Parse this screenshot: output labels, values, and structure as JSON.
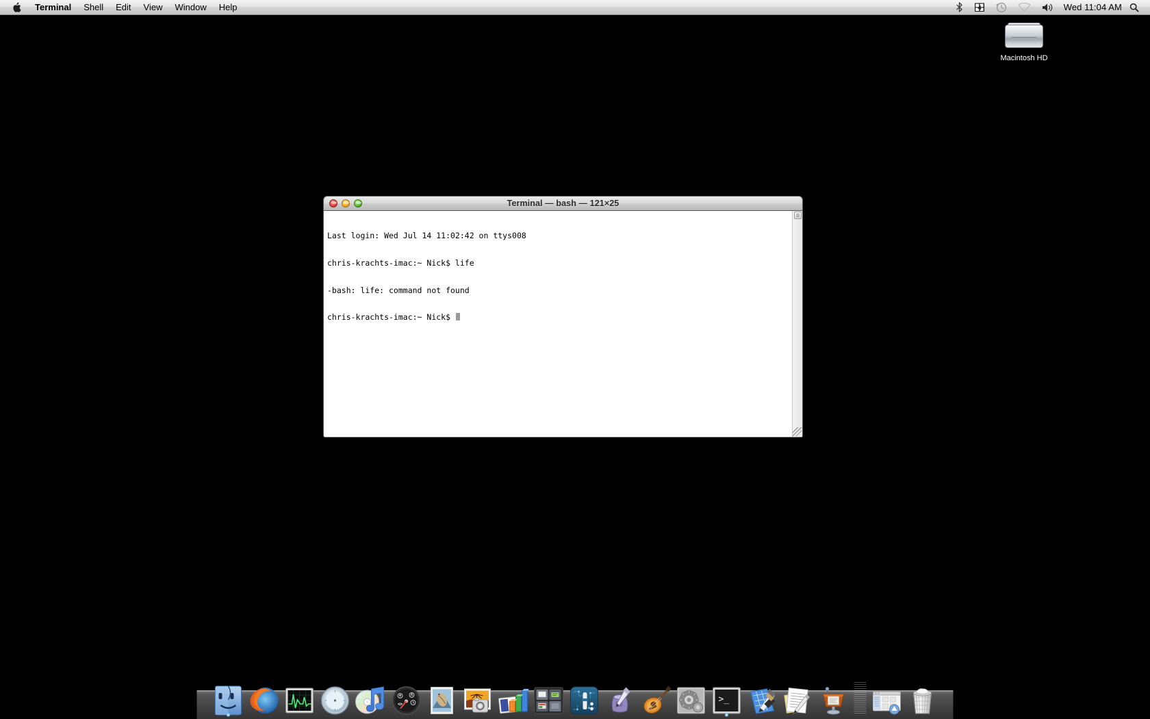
{
  "menubar": {
    "apple_icon": "apple-logo-icon",
    "items": [
      {
        "label": "Terminal",
        "bold": true
      },
      {
        "label": "Shell",
        "bold": false
      },
      {
        "label": "Edit",
        "bold": false
      },
      {
        "label": "View",
        "bold": false
      },
      {
        "label": "Window",
        "bold": false
      },
      {
        "label": "Help",
        "bold": false
      }
    ],
    "status_items": [
      {
        "name": "bluetooth-icon"
      },
      {
        "name": "battery-icon"
      },
      {
        "name": "time-machine-icon"
      },
      {
        "name": "wifi-icon"
      },
      {
        "name": "volume-icon"
      }
    ],
    "clock": "Wed 11:04 AM",
    "search_icon": "spotlight-search-icon"
  },
  "desktop": {
    "background_color": "#000000",
    "icons": [
      {
        "name": "macintosh-hd-icon",
        "label": "Macintosh HD"
      }
    ]
  },
  "terminal": {
    "title": "Terminal — bash — 121×25",
    "traffic_lights": {
      "close": "close-button",
      "minimize": "minimize-button",
      "zoom": "zoom-button"
    },
    "colors": {
      "background": "#ffffff",
      "text": "#000000",
      "cursor": "#9a9a9a"
    },
    "lines": [
      "Last login: Wed Jul 14 11:02:42 on ttys008",
      "chris-krachts-imac:~ Nick$ life",
      "-bash: life: command not found"
    ],
    "prompt": "chris-krachts-imac:~ Nick$ "
  },
  "dock": {
    "items": [
      {
        "name": "finder",
        "label": "Finder",
        "running": true
      },
      {
        "name": "firefox",
        "label": "Firefox",
        "running": false
      },
      {
        "name": "activity-monitor",
        "label": "Activity Monitor",
        "running": false
      },
      {
        "name": "safari",
        "label": "Safari",
        "running": false
      },
      {
        "name": "itunes",
        "label": "iTunes",
        "running": false
      },
      {
        "name": "dashboard",
        "label": "Dashboard",
        "running": false
      },
      {
        "name": "mail",
        "label": "Mail",
        "running": false
      },
      {
        "name": "iphoto",
        "label": "iPhoto",
        "running": false
      },
      {
        "name": "numbers",
        "label": "Numbers",
        "running": false
      },
      {
        "name": "spaces",
        "label": "Spaces",
        "running": false
      },
      {
        "name": "app-store",
        "label": "App Store",
        "running": false
      },
      {
        "name": "iwork-inkwell",
        "label": "iWork",
        "running": false
      },
      {
        "name": "garageband",
        "label": "GarageBand",
        "running": false
      },
      {
        "name": "system-preferences",
        "label": "System Preferences",
        "running": false
      },
      {
        "name": "terminal",
        "label": "Terminal",
        "running": true
      },
      {
        "name": "xcode",
        "label": "Xcode",
        "running": false
      },
      {
        "name": "textedit",
        "label": "TextEdit",
        "running": false
      },
      {
        "name": "keynote",
        "label": "Keynote",
        "running": false
      },
      {
        "name": "separator",
        "label": "",
        "running": false
      },
      {
        "name": "downloads-stack",
        "label": "Downloads",
        "running": false
      },
      {
        "name": "trash",
        "label": "Trash",
        "running": false
      }
    ]
  }
}
